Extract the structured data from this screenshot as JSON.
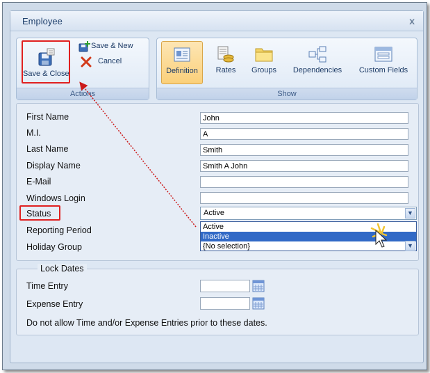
{
  "window": {
    "title": "Employee",
    "close_label": "x"
  },
  "ribbon": {
    "actions": {
      "label": "Actions",
      "save_close": "Save & Close",
      "save_new": "Save & New",
      "cancel": "Cancel"
    },
    "show": {
      "label": "Show",
      "items": [
        "Definition",
        "Rates",
        "Groups",
        "Dependencies",
        "Custom Fields"
      ]
    }
  },
  "form": {
    "first_name": {
      "label": "First Name",
      "value": "John"
    },
    "mi": {
      "label": "M.I.",
      "value": "A"
    },
    "last_name": {
      "label": "Last Name",
      "value": "Smith"
    },
    "display_name": {
      "label": "Display Name",
      "value": "Smith A John"
    },
    "email": {
      "label": "E-Mail",
      "value": ""
    },
    "windows_login": {
      "label": "Windows Login",
      "value": ""
    },
    "status": {
      "label": "Status",
      "value": "Active",
      "options": [
        "Active",
        "Inactive"
      ]
    },
    "reporting_period": {
      "label": "Reporting Period"
    },
    "holiday_group": {
      "label": "Holiday Group",
      "value": "{No selection}"
    }
  },
  "lock_dates": {
    "legend": "Lock Dates",
    "time_entry": {
      "label": "Time Entry",
      "value": ""
    },
    "expense_entry": {
      "label": "Expense Entry",
      "value": ""
    },
    "note": "Do not allow Time and/or Expense Entries prior to these dates."
  },
  "colors": {
    "highlight_red": "#e02020",
    "selection_blue": "#3169c6"
  }
}
